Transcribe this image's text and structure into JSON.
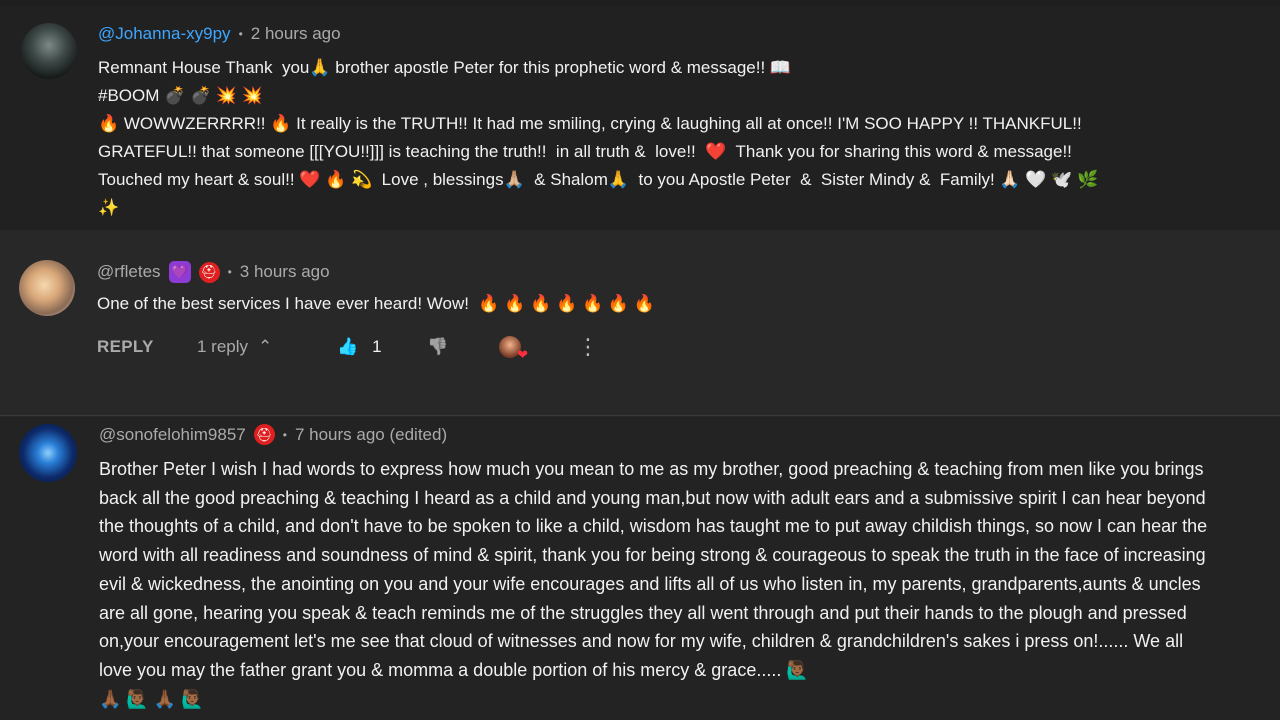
{
  "comments": [
    {
      "author": "@Johanna-xy9py",
      "time": "2 hours ago",
      "text": "Remnant House Thank  you🙏 brother apostle Peter for this prophetic word & message!! 📖\n#BOOM 💣 💣 💥 💥\n🔥 WOWWZERRRR!! 🔥 It really is the TRUTH!! It had me smiling, crying & laughing all at once!! I'M SOO HAPPY !! THANKFUL!!\nGRATEFUL!! that someone [[[YOU!!]]] is teaching the truth!!  in all truth &  love!!  ❤️  Thank you for sharing this word & message!!\nTouched my heart & soul!! ❤️ 🔥 💫  Love , blessings🙏🏼  & Shalom🙏  to you Apostle Peter  &  Sister Mindy &  Family! 🙏🏻 🤍 🕊️ 🌿\n✨"
    },
    {
      "author": "@rfletes",
      "badge_icons": [
        "heart-badge-icon",
        "first-aid-badge-icon"
      ],
      "badge_glyphs": [
        "💜",
        "⛑"
      ],
      "time": "3 hours ago",
      "text": "One of the best services I have ever heard! Wow!  🔥 🔥 🔥 🔥 🔥 🔥 🔥",
      "actions": {
        "reply_label": "REPLY",
        "replies_label": "1 reply",
        "chevron": "⌃",
        "like_glyph": "👍",
        "like_count": "1",
        "dislike_glyph": "👎",
        "more_glyph": "⋮",
        "heart_glyph": "❤"
      }
    },
    {
      "author": "@sonofelohim9857",
      "badge_glyphs": [
        "⛑"
      ],
      "time": "7 hours ago (edited)",
      "text": "Brother Peter I wish I had words to express how much you mean to me as my brother, good preaching & teaching from men like you brings back all the good preaching & teaching I heard as a child and young man,but now with adult ears and a submissive spirit I can hear beyond the thoughts of a child, and don't have to be spoken to like a child, wisdom has taught me to put away childish things, so now I can hear the word with all readiness and soundness of mind & spirit, thank you for being strong & courageous to speak the truth in the face of increasing evil & wickedness, the anointing on you and your wife encourages and lifts all of us who listen in, my parents, grandparents,aunts & uncles are all gone, hearing you speak & teach reminds me of the struggles they all went through and put their hands to the plough and pressed on,your encouragement let's me see that cloud of witnesses and now for my wife, children & grandchildren's sakes i press on!...... We all love you may the father grant you & momma a double portion of his mercy & grace..... 🙋🏾‍♂️\n🙏🏾 🙋🏾‍♂️ 🙏🏾 🙋🏾‍♂️"
    }
  ],
  "separator": "•"
}
